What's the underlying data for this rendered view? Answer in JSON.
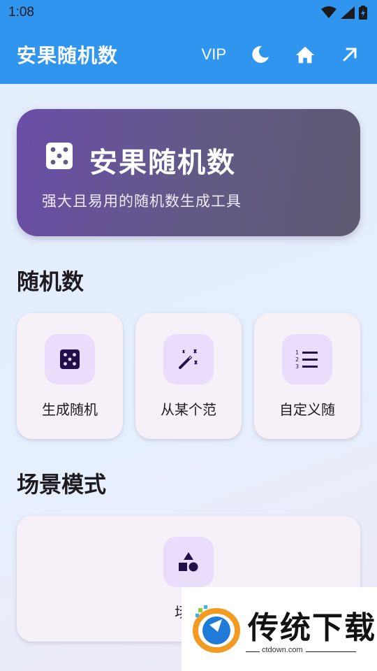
{
  "status_bar": {
    "time": "1:08"
  },
  "app_bar": {
    "title": "安果随机数",
    "vip_label": "VIP",
    "icons": [
      "dark-mode-icon",
      "home-icon",
      "share-arrow-icon"
    ]
  },
  "hero": {
    "title": "安果随机数",
    "subtitle": "强大且易用的随机数生成工具",
    "icon": "dice-icon"
  },
  "sections": {
    "random": {
      "title": "随机数",
      "items": [
        {
          "label": "生成随机",
          "icon": "dice-icon"
        },
        {
          "label": "从某个范",
          "icon": "magic-wand-icon"
        },
        {
          "label": "自定义随",
          "icon": "numbered-list-icon"
        }
      ]
    },
    "scene": {
      "title": "场景模式",
      "items": [
        {
          "label": "场景",
          "icon": "shapes-icon"
        }
      ]
    }
  },
  "watermark": {
    "brand": "传统下载",
    "url": "ctdown.com"
  },
  "colors": {
    "app_bar": "#2f95ee",
    "hero_start": "#6a4ea8",
    "hero_end": "#5e5a72",
    "icon_bg": "#eadcfb",
    "icon_fg": "#23104a"
  }
}
